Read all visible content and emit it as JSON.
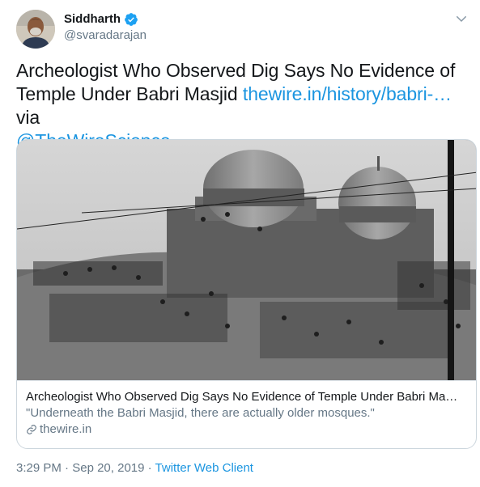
{
  "author": {
    "display_name": "Siddharth",
    "handle": "@svaradarajan"
  },
  "tweet": {
    "text_main": "Archeologist Who Observed Dig Says No Evidence of Temple Under Babri Masjid ",
    "link_text": "thewire.in/history/babri-…",
    "text_via": " via ",
    "mention": "@TheWireScience"
  },
  "card": {
    "title": "Archeologist Who Observed Dig Says No Evidence of Temple Under Babri Ma…",
    "description": "\"Underneath the Babri Masjid, there are actually older mosques.\"",
    "domain": "thewire.in"
  },
  "meta": {
    "time": "3:29 PM",
    "separator": " · ",
    "date": "Sep 20, 2019",
    "client": "Twitter Web Client"
  },
  "colors": {
    "link": "#1b95e0",
    "secondary": "#657786",
    "verified": "#1da1f2",
    "border": "#ccd6dd"
  },
  "icons": [
    "verified-badge-icon",
    "chevron-down-icon",
    "link-icon"
  ]
}
